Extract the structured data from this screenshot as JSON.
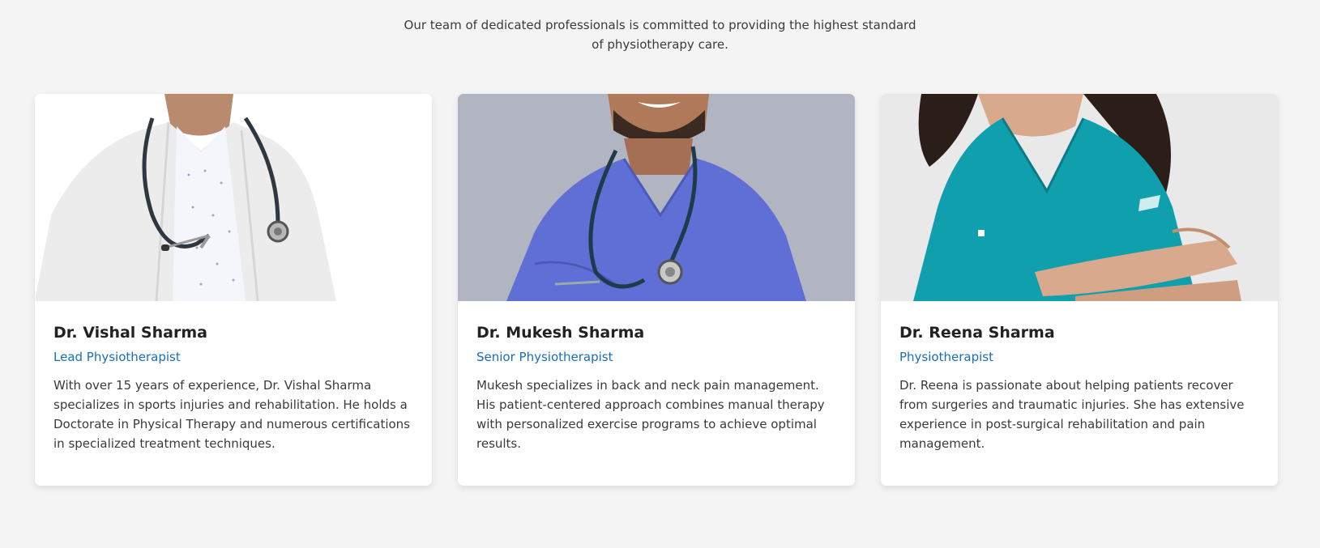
{
  "intro": {
    "text": "Our team of dedicated professionals is committed to providing the highest standard of physiotherapy care."
  },
  "team": [
    {
      "name": "Dr. Vishal Sharma",
      "role": "Lead Physiotherapist",
      "bio": "With over 15 years of experience, Dr. Vishal Sharma specializes in sports injuries and rehabilitation. He holds a Doctorate in Physical Therapy and numerous certifications in specialized treatment techniques."
    },
    {
      "name": "Dr. Mukesh Sharma",
      "role": "Senior Physiotherapist",
      "bio": "Mukesh specializes in back and neck pain management. His patient-centered approach combines manual therapy with personalized exercise programs to achieve optimal results."
    },
    {
      "name": "Dr. Reena Sharma",
      "role": "Physiotherapist",
      "bio": "Dr. Reena is passionate about helping patients recover from surgeries and traumatic injuries. She has extensive experience in post-surgical rehabilitation and pain management."
    }
  ],
  "colors": {
    "page_background": "#f4f4f4",
    "card_background": "#ffffff",
    "role_text": "#1670b5",
    "heading_text": "#222222",
    "body_text": "#3a3a3a"
  },
  "icons": {
    "photo_1": "doctor-white-coat-stethoscope-photo",
    "photo_2": "doctor-blue-scrubs-stethoscope-photo",
    "photo_3": "doctor-teal-scrubs-arms-crossed-photo"
  }
}
